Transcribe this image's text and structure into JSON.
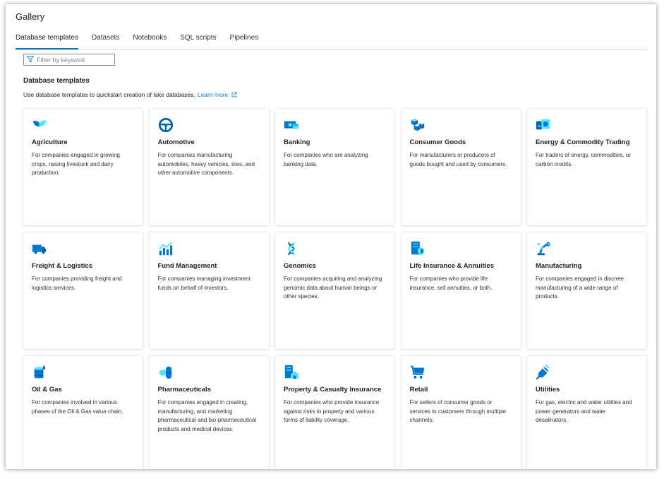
{
  "window": {
    "title": "Gallery"
  },
  "tabs": [
    {
      "label": "Database templates",
      "active": true
    },
    {
      "label": "Datasets",
      "active": false
    },
    {
      "label": "Notebooks",
      "active": false
    },
    {
      "label": "SQL scripts",
      "active": false
    },
    {
      "label": "Pipelines",
      "active": false
    }
  ],
  "filter": {
    "placeholder": "Filter by keyword",
    "value": "",
    "icon": "filter-icon"
  },
  "section": {
    "heading": "Database templates",
    "description": "Use database templates to quickstart creation of lake databases.",
    "learn_more": "Learn more",
    "learn_more_icon": "external-link-icon"
  },
  "colors": {
    "accent": "#0078d4",
    "icon_light": "#50e6ff",
    "icon_dark": "#0063b1"
  },
  "templates": [
    {
      "title": "Agriculture",
      "description": "For companies engaged in growing crops, raising livestock and dairy production.",
      "icon": "leaf-icon"
    },
    {
      "title": "Automotive",
      "description": "For companies manufacturing automobiles, heavy vehicles, tires, and other automotive components.",
      "icon": "steering-wheel-icon"
    },
    {
      "title": "Banking",
      "description": "For companies who are analyzing banking data.",
      "icon": "money-icon"
    },
    {
      "title": "Consumer Goods",
      "description": "For manufacturers or producers of goods bought and used by consumers.",
      "icon": "boxes-icon"
    },
    {
      "title": "Energy & Commodity Trading",
      "description": "For traders of energy, commodities, or carbon credits.",
      "icon": "energy-trading-icon"
    },
    {
      "title": "Freight & Logistics",
      "description": "For companies providing freight and logistics services.",
      "icon": "truck-icon"
    },
    {
      "title": "Fund Management",
      "description": "For companies managing investment funds on behalf of investors.",
      "icon": "chart-growth-icon"
    },
    {
      "title": "Genomics",
      "description": "For companies acquiring and analyzing genomic data about human beings or other species.",
      "icon": "dna-icon"
    },
    {
      "title": "Life Insurance & Annuities",
      "description": "For companies who provide life insurance, sell annuities, or both.",
      "icon": "insurance-document-icon"
    },
    {
      "title": "Manufacturing",
      "description": "For companies engaged in discrete manufacturing of a wide range of products.",
      "icon": "robot-arm-icon"
    },
    {
      "title": "Oil & Gas",
      "description": "For companies involved in various phases of the Oil & Gas value chain.",
      "icon": "oil-barrel-icon"
    },
    {
      "title": "Pharmaceuticals",
      "description": "For companies engaged in creating, manufacturing, and marketing pharmaceutical and bio-pharmaceutical products and medical devices.",
      "icon": "pill-icon"
    },
    {
      "title": "Property & Casualty Insurance",
      "description": "For companies who provide insurance against risks to property and various forms of liability coverage.",
      "icon": "property-insurance-icon"
    },
    {
      "title": "Retail",
      "description": "For sellers of consumer goods or services to customers through multiple channels.",
      "icon": "shopping-cart-icon"
    },
    {
      "title": "Utilities",
      "description": "For gas, electric and water utilities and power generators and water desalinators.",
      "icon": "power-plug-icon"
    }
  ]
}
